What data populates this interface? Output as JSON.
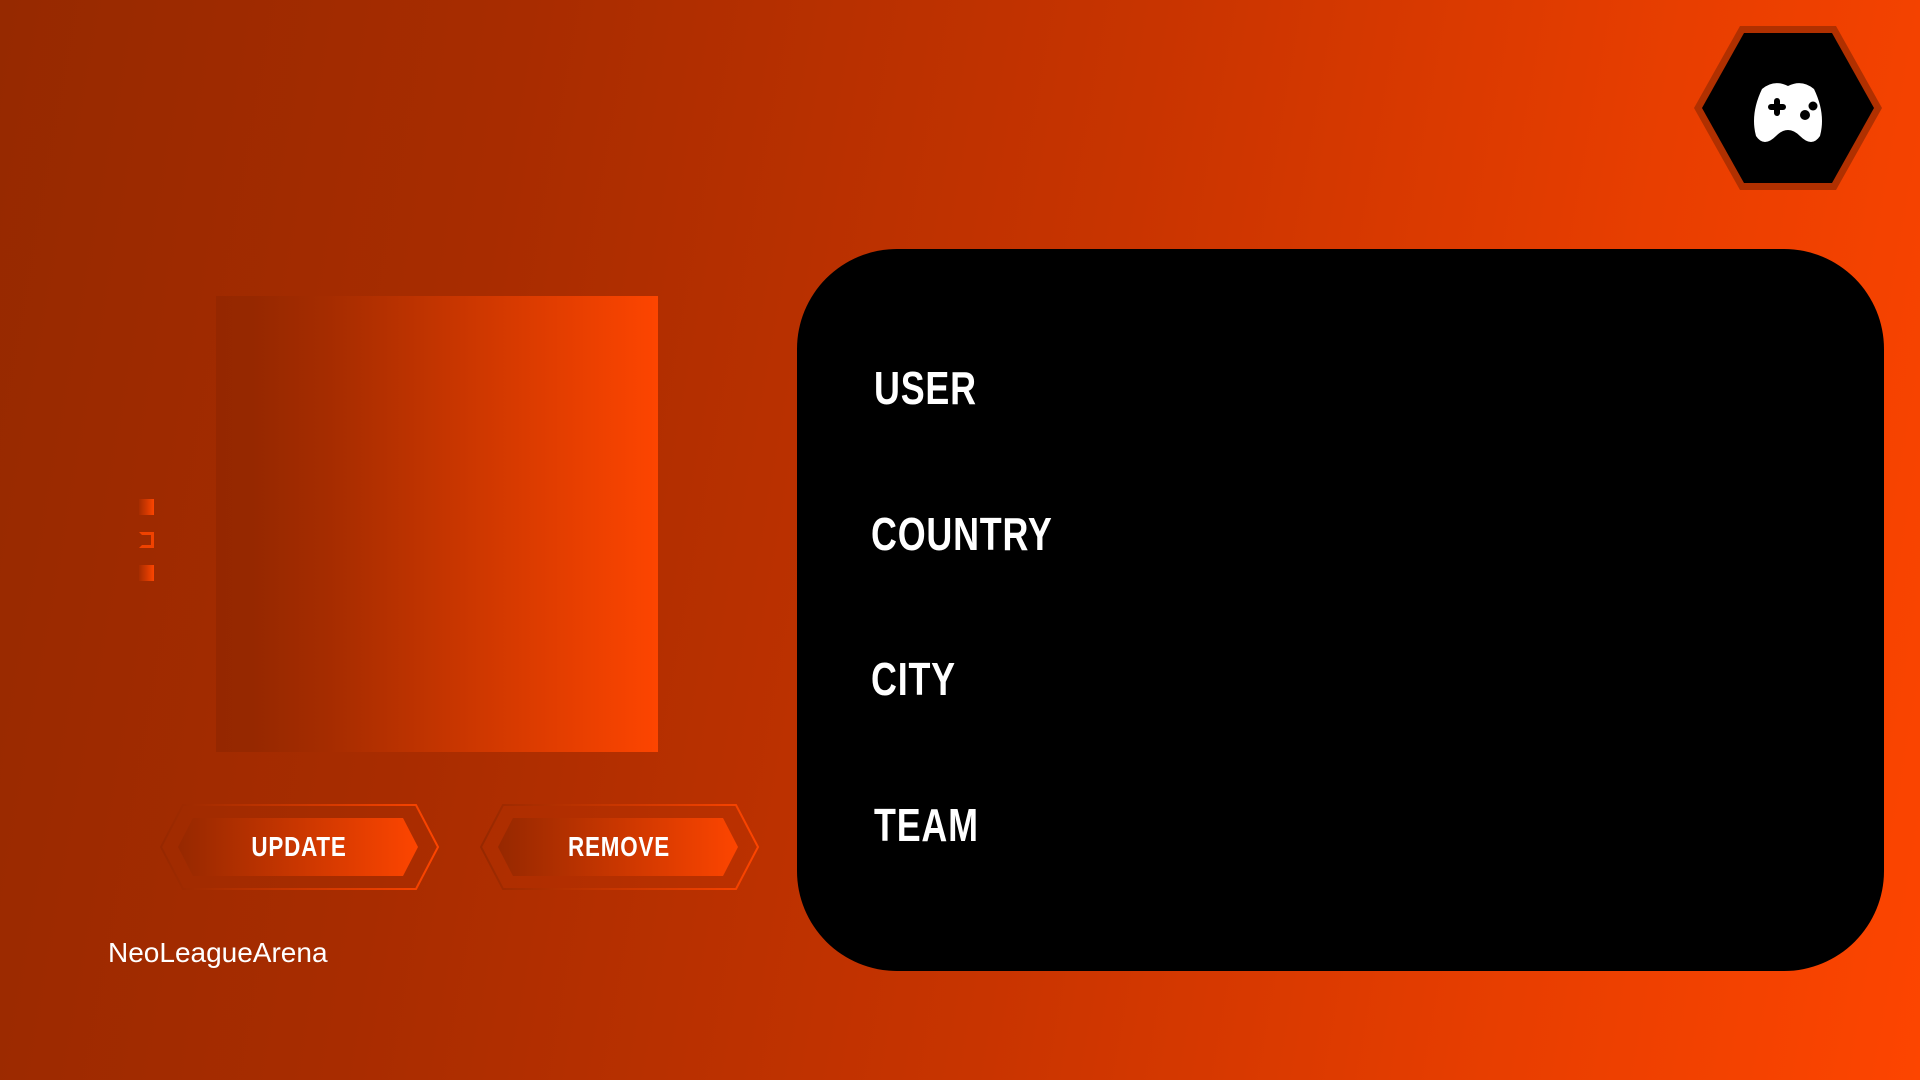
{
  "brand": "NeoLeagueArena",
  "buttons": {
    "update": "UPDATE",
    "remove": "REMOVE"
  },
  "profile": {
    "fields": [
      "USER",
      "COUNTRY",
      "CITY",
      "TEAM"
    ]
  },
  "icons": {
    "logo": "gamepad-icon"
  },
  "colors": {
    "dark": "#962800",
    "accent": "#fd4500",
    "panel": "#000000"
  }
}
